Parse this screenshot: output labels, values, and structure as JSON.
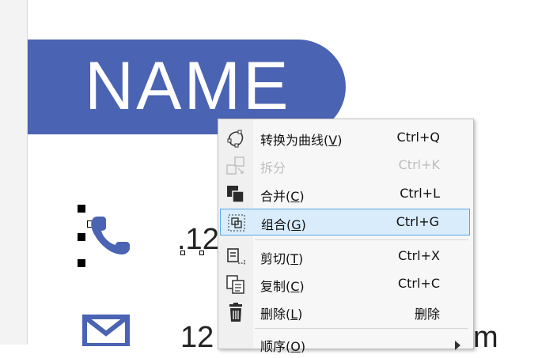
{
  "card": {
    "name_text": "NAME",
    "phone_text": ".12",
    "email_text": "12",
    "email_tail": "m",
    "accent_color": "#4a63b2"
  },
  "context_menu": {
    "items": [
      {
        "icon": "convert-to-curves-icon",
        "label": "转换为曲线(",
        "key": "V",
        "shortcut": "Ctrl+Q",
        "disabled": false
      },
      {
        "icon": "break-apart-icon",
        "label": "拆分",
        "key": "",
        "shortcut": "Ctrl+K",
        "disabled": true
      },
      {
        "icon": "combine-icon",
        "label": "合并(",
        "key": "C",
        "shortcut": "Ctrl+L",
        "disabled": false
      },
      {
        "icon": "group-icon",
        "label": "组合(",
        "key": "G",
        "shortcut": "Ctrl+G",
        "disabled": false,
        "highlighted": true
      },
      {
        "icon": "cut-icon",
        "label": "剪切(",
        "key": "T",
        "shortcut": "Ctrl+X",
        "disabled": false
      },
      {
        "icon": "copy-icon",
        "label": "复制(",
        "key": "C",
        "shortcut": "Ctrl+C",
        "disabled": false
      },
      {
        "icon": "delete-icon",
        "label": "删除(",
        "key": "L",
        "shortcut": "删除",
        "disabled": false
      },
      {
        "icon": "order-icon",
        "label": "顺序(",
        "key": "O",
        "shortcut": "",
        "disabled": false,
        "submenu": true
      }
    ]
  }
}
